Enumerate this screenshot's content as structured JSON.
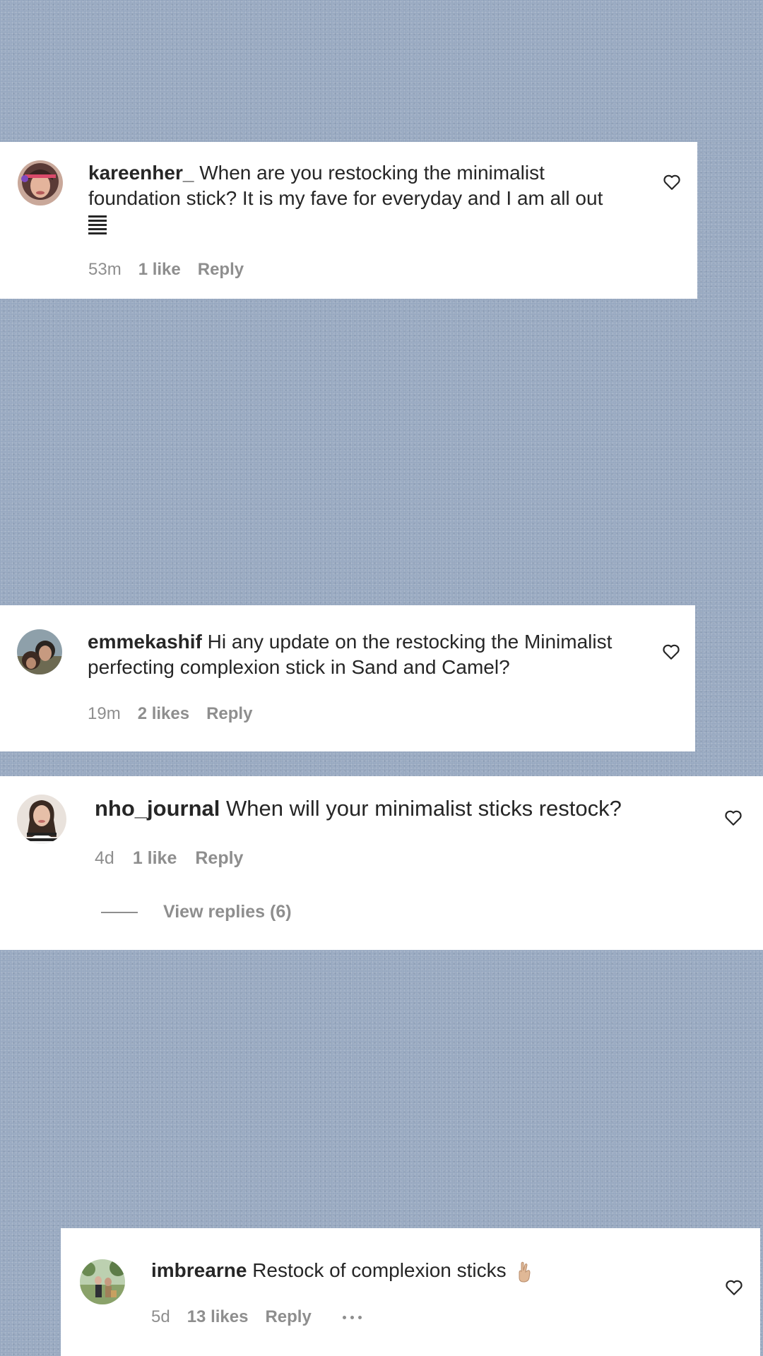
{
  "comments": [
    {
      "username": "kareenher_",
      "text": "When are you restocking the minimalist foundation stick? It is my fave for everyday and I am all out",
      "emoji_icon": "bars-icon",
      "time": "53m",
      "likes": "1 like",
      "reply": "Reply"
    },
    {
      "username": "emmekashif",
      "text": "Hi any update on the restocking the Minimalist perfecting complexion stick in Sand and Camel?",
      "time": "19m",
      "likes": "2 likes",
      "reply": "Reply"
    },
    {
      "username": "nho_journal",
      "text": "When will your minimalist sticks restock?",
      "time": "4d",
      "likes": "1 like",
      "reply": "Reply",
      "view_replies": "View replies (6)"
    },
    {
      "username": "imbrearne",
      "text": "Restock of complexion sticks",
      "emoji_icon": "crossed-fingers-icon",
      "time": "5d",
      "likes": "13 likes",
      "reply": "Reply",
      "more_icon": "more-options-icon"
    }
  ],
  "colors": {
    "background": "#97a8c0",
    "card": "#ffffff",
    "text": "#262626",
    "meta": "#8e8e8e"
  }
}
